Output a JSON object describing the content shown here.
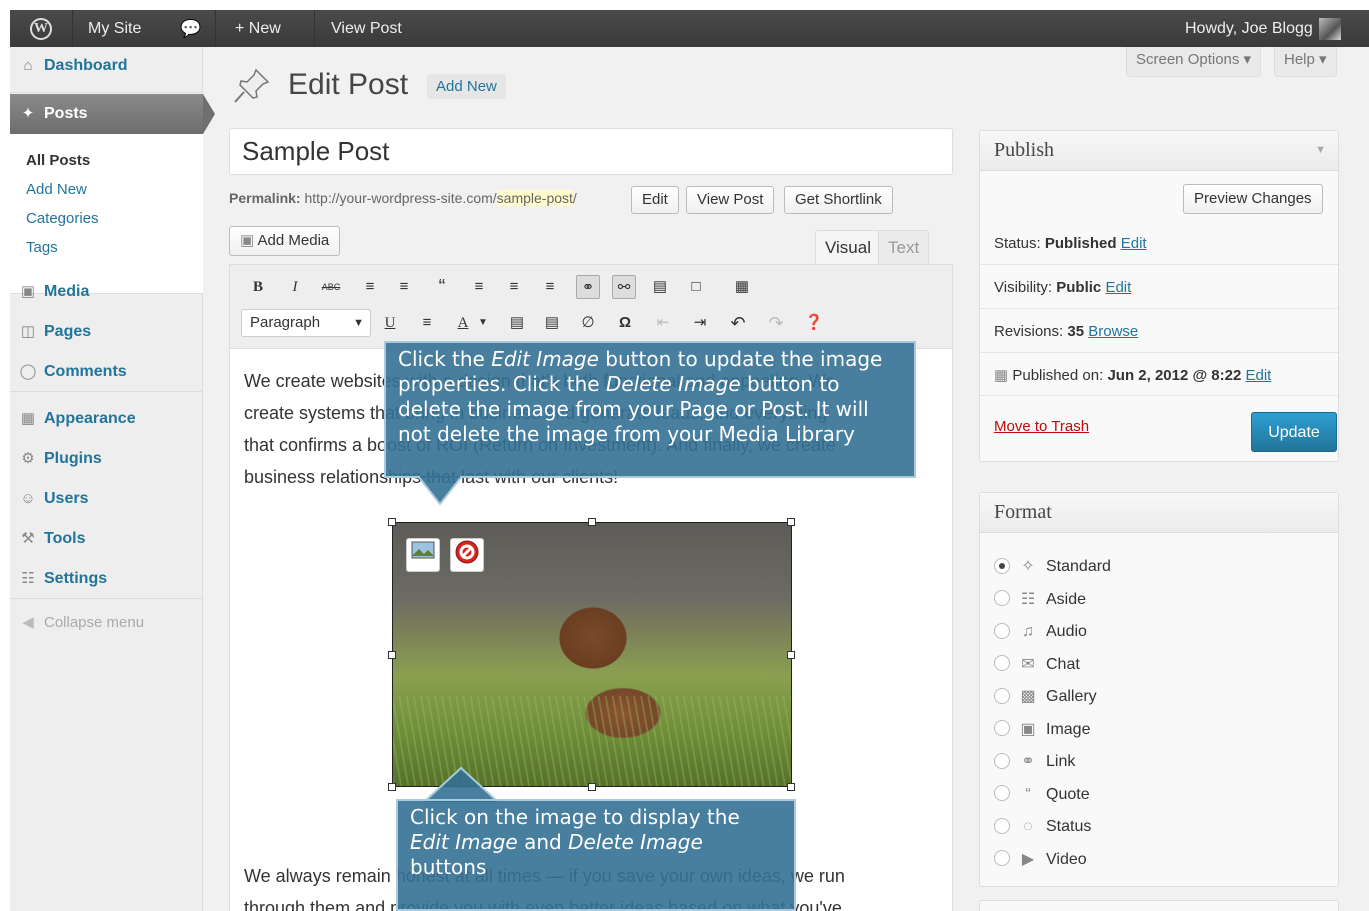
{
  "adminbar": {
    "site_name": "My Site",
    "new_label": "+ New",
    "view_post": "View Post",
    "howdy": "Howdy, Joe Blogg"
  },
  "sidebar": {
    "dashboard": "Dashboard",
    "posts": "Posts",
    "submenu": [
      "All Posts",
      "Add New",
      "Categories",
      "Tags"
    ],
    "media": "Media",
    "pages": "Pages",
    "comments": "Comments",
    "appearance": "Appearance",
    "plugins": "Plugins",
    "users": "Users",
    "tools": "Tools",
    "settings": "Settings",
    "collapse": "Collapse menu"
  },
  "header": {
    "title": "Edit Post",
    "add_new": "Add New",
    "screen_options": "Screen Options",
    "help": "Help"
  },
  "post": {
    "title": "Sample Post",
    "permalink_label": "Permalink:",
    "permalink_url": "http://your-wordpress-site.com/",
    "permalink_slug": "sample-post",
    "permalink_end": "/",
    "edit_btn": "Edit",
    "view_btn": "View Post",
    "shortlink_btn": "Get Shortlink",
    "add_media": "Add Media",
    "tab_visual": "Visual",
    "tab_text": "Text",
    "format_select": "Paragraph"
  },
  "content": {
    "line1": "We create websites with a design that's both functional and appealing. We",
    "line2": "create systems that bring in business and generate leads, and everything",
    "line3": "that confirms a boost of ROI (Return on Investment). And finally, we create",
    "line4": "business relationships that last with our clients!",
    "line5": "We always remain honest at all times — if you save your own ideas, we run",
    "line6": "through them and provide you with even better ideas based on what you've"
  },
  "callouts": {
    "top_a": "Click the ",
    "top_b": "Edit Image",
    "top_c": " button to update the image properties. Click the ",
    "top_d": "Delete Image",
    "top_e": " button to delete the image from your Page or Post. It will not delete the image from your Media Library",
    "bottom_a": "Click on the image to display the ",
    "bottom_b": "Edit Image",
    "bottom_c": " and ",
    "bottom_d": "Delete Image",
    "bottom_e": " buttons"
  },
  "publish": {
    "heading": "Publish",
    "preview": "Preview Changes",
    "status_label": "Status:",
    "status_value": "Published",
    "visibility_label": "Visibility:",
    "visibility_value": "Public",
    "revisions_label": "Revisions:",
    "revisions_value": "35",
    "browse": "Browse",
    "published_on_label": "Published on:",
    "published_on_value": "Jun 2, 2012 @ 8:22",
    "edit": "Edit",
    "trash": "Move to Trash",
    "update": "Update"
  },
  "format": {
    "heading": "Format",
    "options": [
      "Standard",
      "Aside",
      "Audio",
      "Chat",
      "Gallery",
      "Image",
      "Link",
      "Quote",
      "Status",
      "Video"
    ],
    "selected": "Standard"
  },
  "colors": {
    "link": "#21759b",
    "callout": "#347094",
    "update_button": "#2e9fd2",
    "trash": "#bc0b0b"
  }
}
